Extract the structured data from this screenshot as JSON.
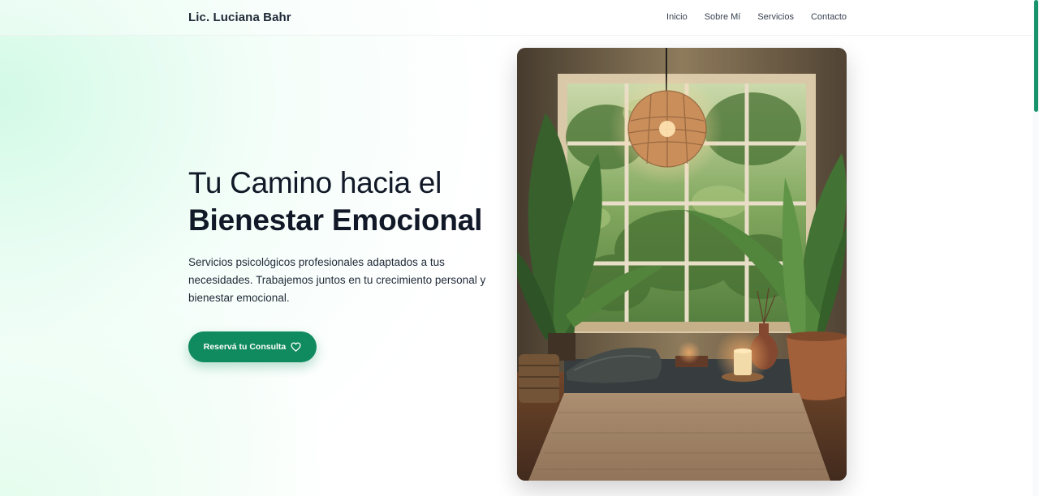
{
  "header": {
    "brand": "Lic. Luciana Bahr",
    "nav": [
      "Inicio",
      "Sobre Mí",
      "Servicios",
      "Contacto"
    ]
  },
  "hero": {
    "title_light": "Tu Camino hacia el",
    "title_bold": "Bienestar Emocional",
    "description": "Servicios psicológicos profesionales adaptados a tus necesidades. Trabajemos juntos en tu crecimiento personal y bienestar emocional.",
    "cta_label": "Reservá tu Consulta",
    "cta_icon": "heart-icon"
  },
  "image": {
    "subject": "meditation-room-photo"
  },
  "colors": {
    "accent": "#108a5f",
    "background_glow": "#d1fae5",
    "text": "#111827"
  }
}
